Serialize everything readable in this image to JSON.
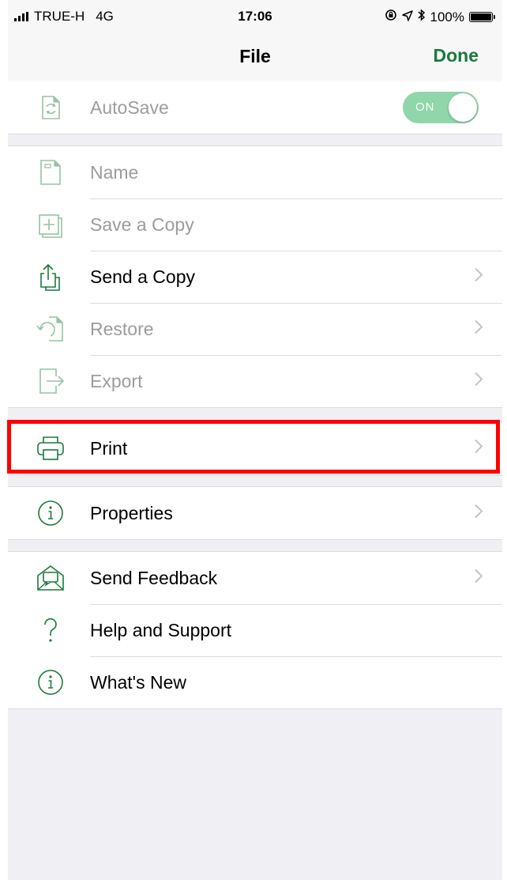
{
  "status_bar": {
    "carrier": "TRUE-H",
    "network": "4G",
    "time": "17:06",
    "battery": "100%",
    "icons": [
      "signal-bars-icon",
      "orientation-lock-icon",
      "location-icon",
      "bluetooth-icon",
      "battery-icon"
    ]
  },
  "nav": {
    "title": "File",
    "done_label": "Done",
    "accent_color": "#1a7a3c"
  },
  "autosave": {
    "label": "AutoSave",
    "toggle_text": "ON",
    "toggle_on": true
  },
  "file_items": [
    {
      "label": "Name",
      "enabled": false,
      "chevron": false,
      "icon": "document-icon"
    },
    {
      "label": "Save a Copy",
      "enabled": false,
      "chevron": false,
      "icon": "save-copy-icon"
    },
    {
      "label": "Send a Copy",
      "enabled": true,
      "chevron": true,
      "icon": "share-icon"
    },
    {
      "label": "Restore",
      "enabled": false,
      "chevron": true,
      "icon": "restore-icon"
    },
    {
      "label": "Export",
      "enabled": false,
      "chevron": true,
      "icon": "export-icon"
    }
  ],
  "print": {
    "label": "Print",
    "icon": "printer-icon",
    "highlight_color": "#ff0000"
  },
  "properties": {
    "label": "Properties",
    "icon": "info-icon"
  },
  "support_items": [
    {
      "label": "Send Feedback",
      "chevron": true,
      "icon": "feedback-icon"
    },
    {
      "label": "Help and Support",
      "chevron": false,
      "icon": "question-icon"
    },
    {
      "label": "What's New",
      "chevron": false,
      "icon": "info-icon"
    }
  ]
}
